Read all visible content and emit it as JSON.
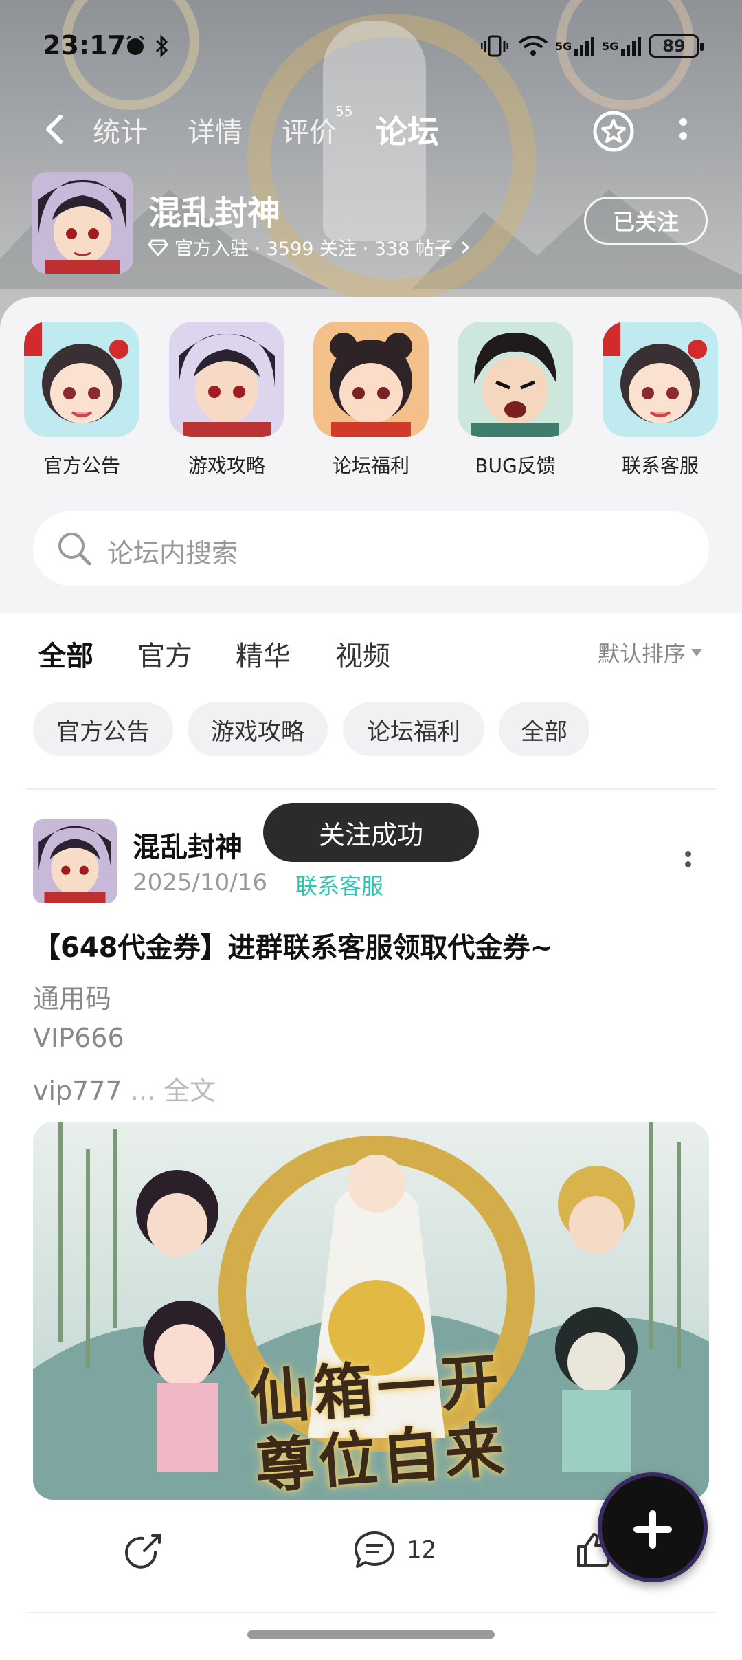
{
  "status_bar": {
    "time": "23:17",
    "signal_labels": [
      "5G",
      "5G"
    ],
    "battery": "89"
  },
  "nav": {
    "tabs": [
      {
        "label": "统计"
      },
      {
        "label": "详情"
      },
      {
        "label": "评价"
      },
      {
        "label": "论坛"
      }
    ],
    "review_count": "55",
    "active_tab": "论坛"
  },
  "game": {
    "name": "混乱封神",
    "meta": "官方入驻 · 3599 关注 · 338 帖子",
    "follow_label": "已关注"
  },
  "categories": [
    {
      "label": "官方公告"
    },
    {
      "label": "游戏攻略"
    },
    {
      "label": "论坛福利"
    },
    {
      "label": "BUG反馈"
    },
    {
      "label": "联系客服"
    }
  ],
  "search": {
    "placeholder": "论坛内搜索"
  },
  "filter_tabs": [
    {
      "label": "全部"
    },
    {
      "label": "官方"
    },
    {
      "label": "精华"
    },
    {
      "label": "视频"
    }
  ],
  "sort_label": "默认排序",
  "chips": [
    {
      "label": "官方公告"
    },
    {
      "label": "游戏攻略"
    },
    {
      "label": "论坛福利"
    },
    {
      "label": "全部"
    }
  ],
  "post": {
    "author": "混乱封神",
    "date": "2025/10/16",
    "tag": "联系客服",
    "title": "【648代金券】进群联系客服领取代金券~",
    "lines": [
      "通用码",
      "VIP666",
      "vip777"
    ],
    "ellipsis": " ... ",
    "full_text_label": "全文",
    "image_caption_line1": "仙箱一开",
    "image_caption_line2": "尊位自来",
    "comment_count": "12"
  },
  "toast": "关注成功",
  "colors": {
    "accent": "#2ac6b0",
    "toast_bg": "#2b2b2b"
  }
}
